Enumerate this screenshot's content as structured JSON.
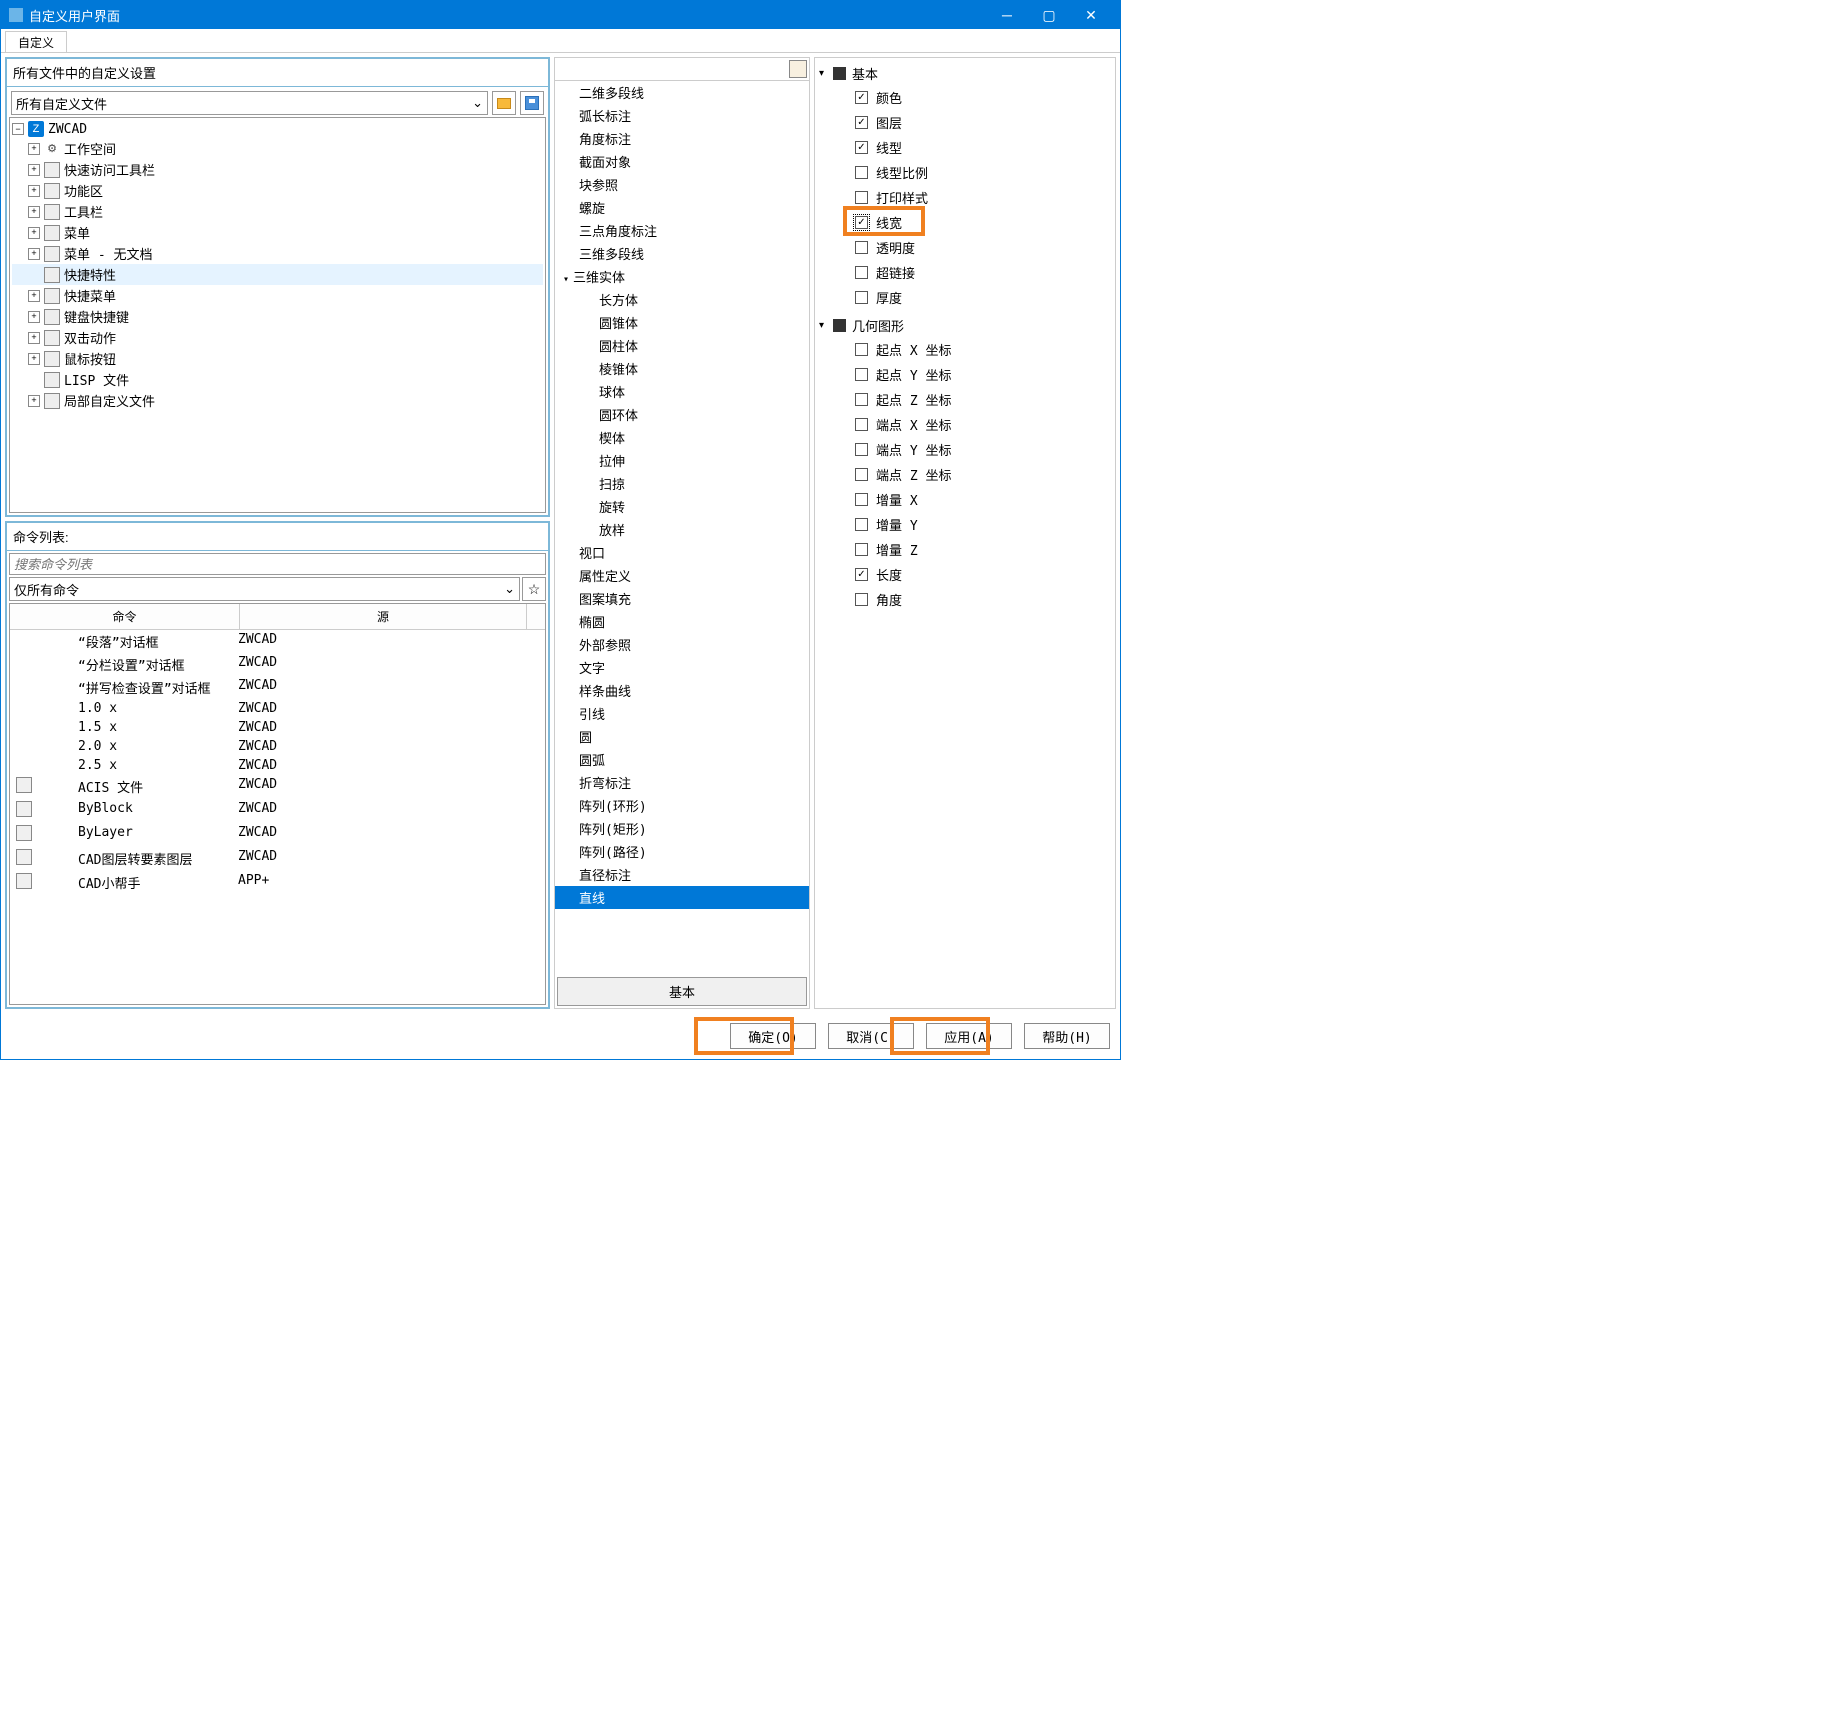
{
  "title": "自定义用户界面",
  "tab": "自定义",
  "leftTop": {
    "header": "所有文件中的自定义设置",
    "dropdown": "所有自定义文件",
    "tree": [
      {
        "toggle": "−",
        "depth": 0,
        "icon": "zwcad",
        "label": "ZWCAD"
      },
      {
        "toggle": "+",
        "depth": 1,
        "icon": "gear",
        "label": "工作空间"
      },
      {
        "toggle": "+",
        "depth": 1,
        "icon": "misc",
        "label": "快速访问工具栏"
      },
      {
        "toggle": "+",
        "depth": 1,
        "icon": "misc",
        "label": "功能区"
      },
      {
        "toggle": "+",
        "depth": 1,
        "icon": "misc",
        "label": "工具栏"
      },
      {
        "toggle": "+",
        "depth": 1,
        "icon": "misc",
        "label": "菜单"
      },
      {
        "toggle": "+",
        "depth": 1,
        "icon": "misc",
        "label": "菜单 - 无文档"
      },
      {
        "toggle": "",
        "depth": 1,
        "icon": "misc",
        "label": "快捷特性",
        "selected": true
      },
      {
        "toggle": "+",
        "depth": 1,
        "icon": "misc",
        "label": "快捷菜单"
      },
      {
        "toggle": "+",
        "depth": 1,
        "icon": "misc",
        "label": "键盘快捷键"
      },
      {
        "toggle": "+",
        "depth": 1,
        "icon": "misc",
        "label": "双击动作"
      },
      {
        "toggle": "+",
        "depth": 1,
        "icon": "misc",
        "label": "鼠标按钮"
      },
      {
        "toggle": "",
        "depth": 1,
        "icon": "misc",
        "label": "LISP  文件"
      },
      {
        "toggle": "+",
        "depth": 1,
        "icon": "misc",
        "label": "局部自定义文件"
      }
    ]
  },
  "leftBottom": {
    "header": "命令列表:",
    "searchPlaceholder": "搜索命令列表",
    "filter": "仅所有命令",
    "headers": {
      "cmd": "命令",
      "src": "源"
    },
    "rows": [
      {
        "icon": false,
        "cmd": "“段落”对话框",
        "src": "ZWCAD"
      },
      {
        "icon": false,
        "cmd": "“分栏设置”对话框",
        "src": "ZWCAD"
      },
      {
        "icon": false,
        "cmd": "“拼写检查设置”对话框",
        "src": "ZWCAD"
      },
      {
        "icon": false,
        "cmd": "1.0 x",
        "src": "ZWCAD"
      },
      {
        "icon": false,
        "cmd": "1.5 x",
        "src": "ZWCAD"
      },
      {
        "icon": false,
        "cmd": "2.0 x",
        "src": "ZWCAD"
      },
      {
        "icon": false,
        "cmd": "2.5 x",
        "src": "ZWCAD"
      },
      {
        "icon": true,
        "cmd": "ACIS 文件",
        "src": "ZWCAD"
      },
      {
        "icon": true,
        "cmd": "ByBlock",
        "src": "ZWCAD"
      },
      {
        "icon": true,
        "cmd": "ByLayer",
        "src": "ZWCAD"
      },
      {
        "icon": true,
        "cmd": "CAD图层转要素图层",
        "src": "ZWCAD"
      },
      {
        "icon": true,
        "cmd": "CAD小帮手",
        "src": "APP+"
      }
    ]
  },
  "mid": {
    "items": [
      {
        "label": "二维多段线",
        "lvl": 1
      },
      {
        "label": "弧长标注",
        "lvl": 1
      },
      {
        "label": "角度标注",
        "lvl": 1
      },
      {
        "label": "截面对象",
        "lvl": 1
      },
      {
        "label": "块参照",
        "lvl": 1
      },
      {
        "label": "螺旋",
        "lvl": 1
      },
      {
        "label": "三点角度标注",
        "lvl": 1
      },
      {
        "label": "三维多段线",
        "lvl": 1
      },
      {
        "label": "三维实体",
        "lvl": 1,
        "children": true
      },
      {
        "label": "长方体",
        "lvl": 2
      },
      {
        "label": "圆锥体",
        "lvl": 2
      },
      {
        "label": "圆柱体",
        "lvl": 2
      },
      {
        "label": "棱锥体",
        "lvl": 2
      },
      {
        "label": "球体",
        "lvl": 2
      },
      {
        "label": "圆环体",
        "lvl": 2
      },
      {
        "label": "楔体",
        "lvl": 2
      },
      {
        "label": "拉伸",
        "lvl": 2
      },
      {
        "label": "扫掠",
        "lvl": 2
      },
      {
        "label": "旋转",
        "lvl": 2
      },
      {
        "label": "放样",
        "lvl": 2
      },
      {
        "label": "视口",
        "lvl": 1
      },
      {
        "label": "属性定义",
        "lvl": 1
      },
      {
        "label": "图案填充",
        "lvl": 1
      },
      {
        "label": "椭圆",
        "lvl": 1
      },
      {
        "label": "外部参照",
        "lvl": 1
      },
      {
        "label": "文字",
        "lvl": 1
      },
      {
        "label": "样条曲线",
        "lvl": 1
      },
      {
        "label": "引线",
        "lvl": 1
      },
      {
        "label": "圆",
        "lvl": 1
      },
      {
        "label": "圆弧",
        "lvl": 1
      },
      {
        "label": "折弯标注",
        "lvl": 1
      },
      {
        "label": "阵列(环形)",
        "lvl": 1
      },
      {
        "label": "阵列(矩形)",
        "lvl": 1
      },
      {
        "label": "阵列(路径)",
        "lvl": 1
      },
      {
        "label": "直径标注",
        "lvl": 1
      },
      {
        "label": "直线",
        "lvl": 1,
        "selected": true
      }
    ],
    "footer": "基本"
  },
  "right": {
    "groups": [
      {
        "label": "基本",
        "expanded": true,
        "items": [
          {
            "label": "颜色",
            "checked": true
          },
          {
            "label": "图层",
            "checked": true
          },
          {
            "label": "线型",
            "checked": true
          },
          {
            "label": "线型比例",
            "checked": false
          },
          {
            "label": "打印样式",
            "checked": false
          },
          {
            "label": "线宽",
            "checked": true,
            "highlight": true
          },
          {
            "label": "透明度",
            "checked": false
          },
          {
            "label": "超链接",
            "checked": false
          },
          {
            "label": "厚度",
            "checked": false
          }
        ]
      },
      {
        "label": "几何图形",
        "expanded": true,
        "items": [
          {
            "label": "起点 X 坐标",
            "checked": false
          },
          {
            "label": "起点 Y 坐标",
            "checked": false
          },
          {
            "label": "起点 Z 坐标",
            "checked": false
          },
          {
            "label": "端点 X 坐标",
            "checked": false
          },
          {
            "label": "端点 Y 坐标",
            "checked": false
          },
          {
            "label": "端点 Z 坐标",
            "checked": false
          },
          {
            "label": "增量 X",
            "checked": false
          },
          {
            "label": "增量 Y",
            "checked": false
          },
          {
            "label": "增量 Z",
            "checked": false
          },
          {
            "label": "长度",
            "checked": true
          },
          {
            "label": "角度",
            "checked": false
          }
        ]
      }
    ]
  },
  "buttons": {
    "ok": "确定(O)",
    "cancel": "取消(C)",
    "apply": "应用(A)",
    "help": "帮助(H)"
  }
}
